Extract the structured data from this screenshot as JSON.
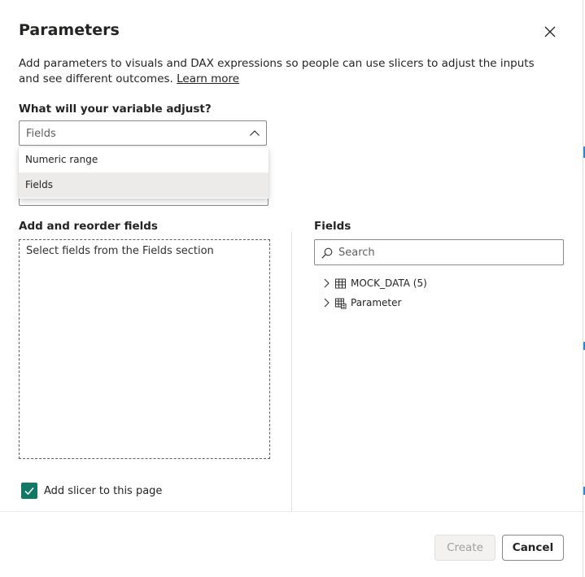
{
  "dialog": {
    "title": "Parameters",
    "description": "Add parameters to visuals and DAX expressions so people can use slicers to adjust the inputs and see different outcomes.",
    "learn_more": "Learn more",
    "question": "What will your variable adjust?"
  },
  "variable_select": {
    "value": "Fields",
    "options": [
      "Numeric range",
      "Fields"
    ],
    "selected_option": "Fields"
  },
  "left_panel": {
    "label": "Add and reorder fields",
    "drop_zone_text": "Select fields from the Fields section"
  },
  "right_panel": {
    "label": "Fields",
    "search_placeholder": "Search",
    "tree": [
      {
        "label": "MOCK_DATA (5)",
        "icon": "table-icon"
      },
      {
        "label": "Parameter",
        "icon": "calculated-table-icon"
      }
    ]
  },
  "slicer": {
    "label": "Add slicer to this page",
    "checked": true
  },
  "footer": {
    "create_label": "Create",
    "cancel_label": "Cancel"
  },
  "colors": {
    "checkbox": "#117865",
    "edge_accent": "#2b88d8"
  }
}
